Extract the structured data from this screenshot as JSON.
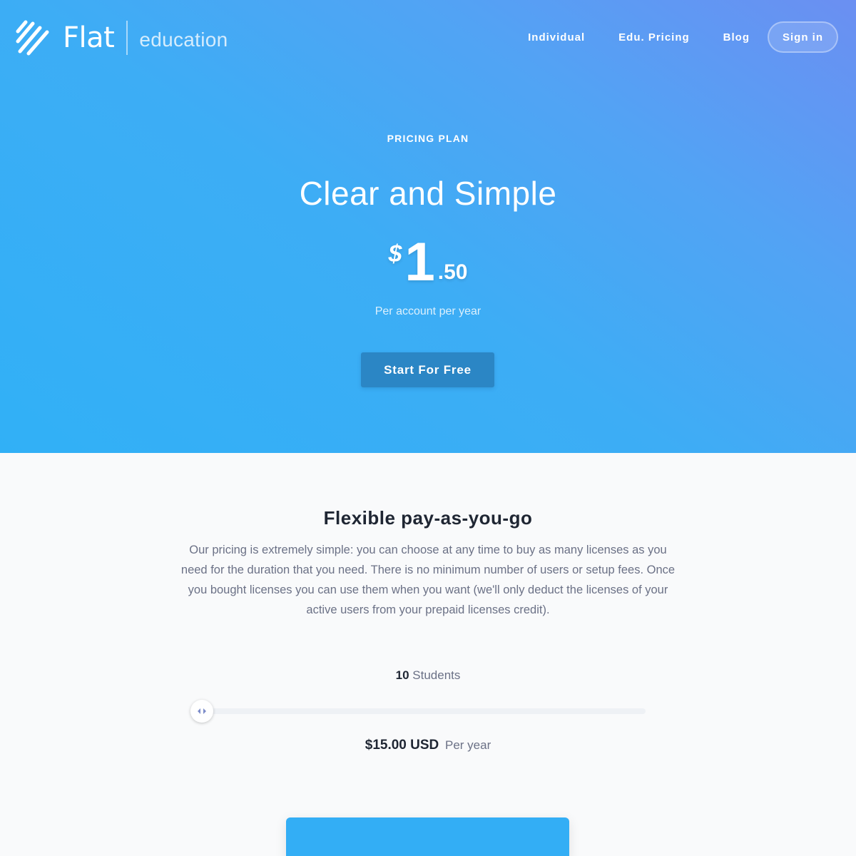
{
  "header": {
    "logo_word": "Flat",
    "logo_sub": "education",
    "nav": [
      "Individual",
      "Edu. Pricing",
      "Blog"
    ],
    "signin_label": "Sign in"
  },
  "hero": {
    "eyebrow": "PRICING PLAN",
    "headline": "Clear and Simple",
    "price": {
      "currency": "$",
      "integer": "1",
      "decimal": ".50"
    },
    "per": "Per account per year",
    "cta_label": "Start For Free"
  },
  "pricing": {
    "title": "Flexible pay-as-you-go",
    "body": "Our pricing is extremely simple: you can choose at any time to buy as many licenses as you need for the duration that you need. There is no minimum number of users or setup fees. Once you bought licenses you can use them when you want (we'll only deduct the licenses of your active users from your prepaid licenses credit).",
    "students_count": "10",
    "students_label": "Students",
    "total_amount": "$15.00 USD",
    "total_period": "Per year",
    "slider_value_fraction": 0
  },
  "colors": {
    "hero_start": "#31b0f6",
    "hero_end": "#6b8ff2",
    "cta": "#2b86c5",
    "card": "#33aef5"
  }
}
